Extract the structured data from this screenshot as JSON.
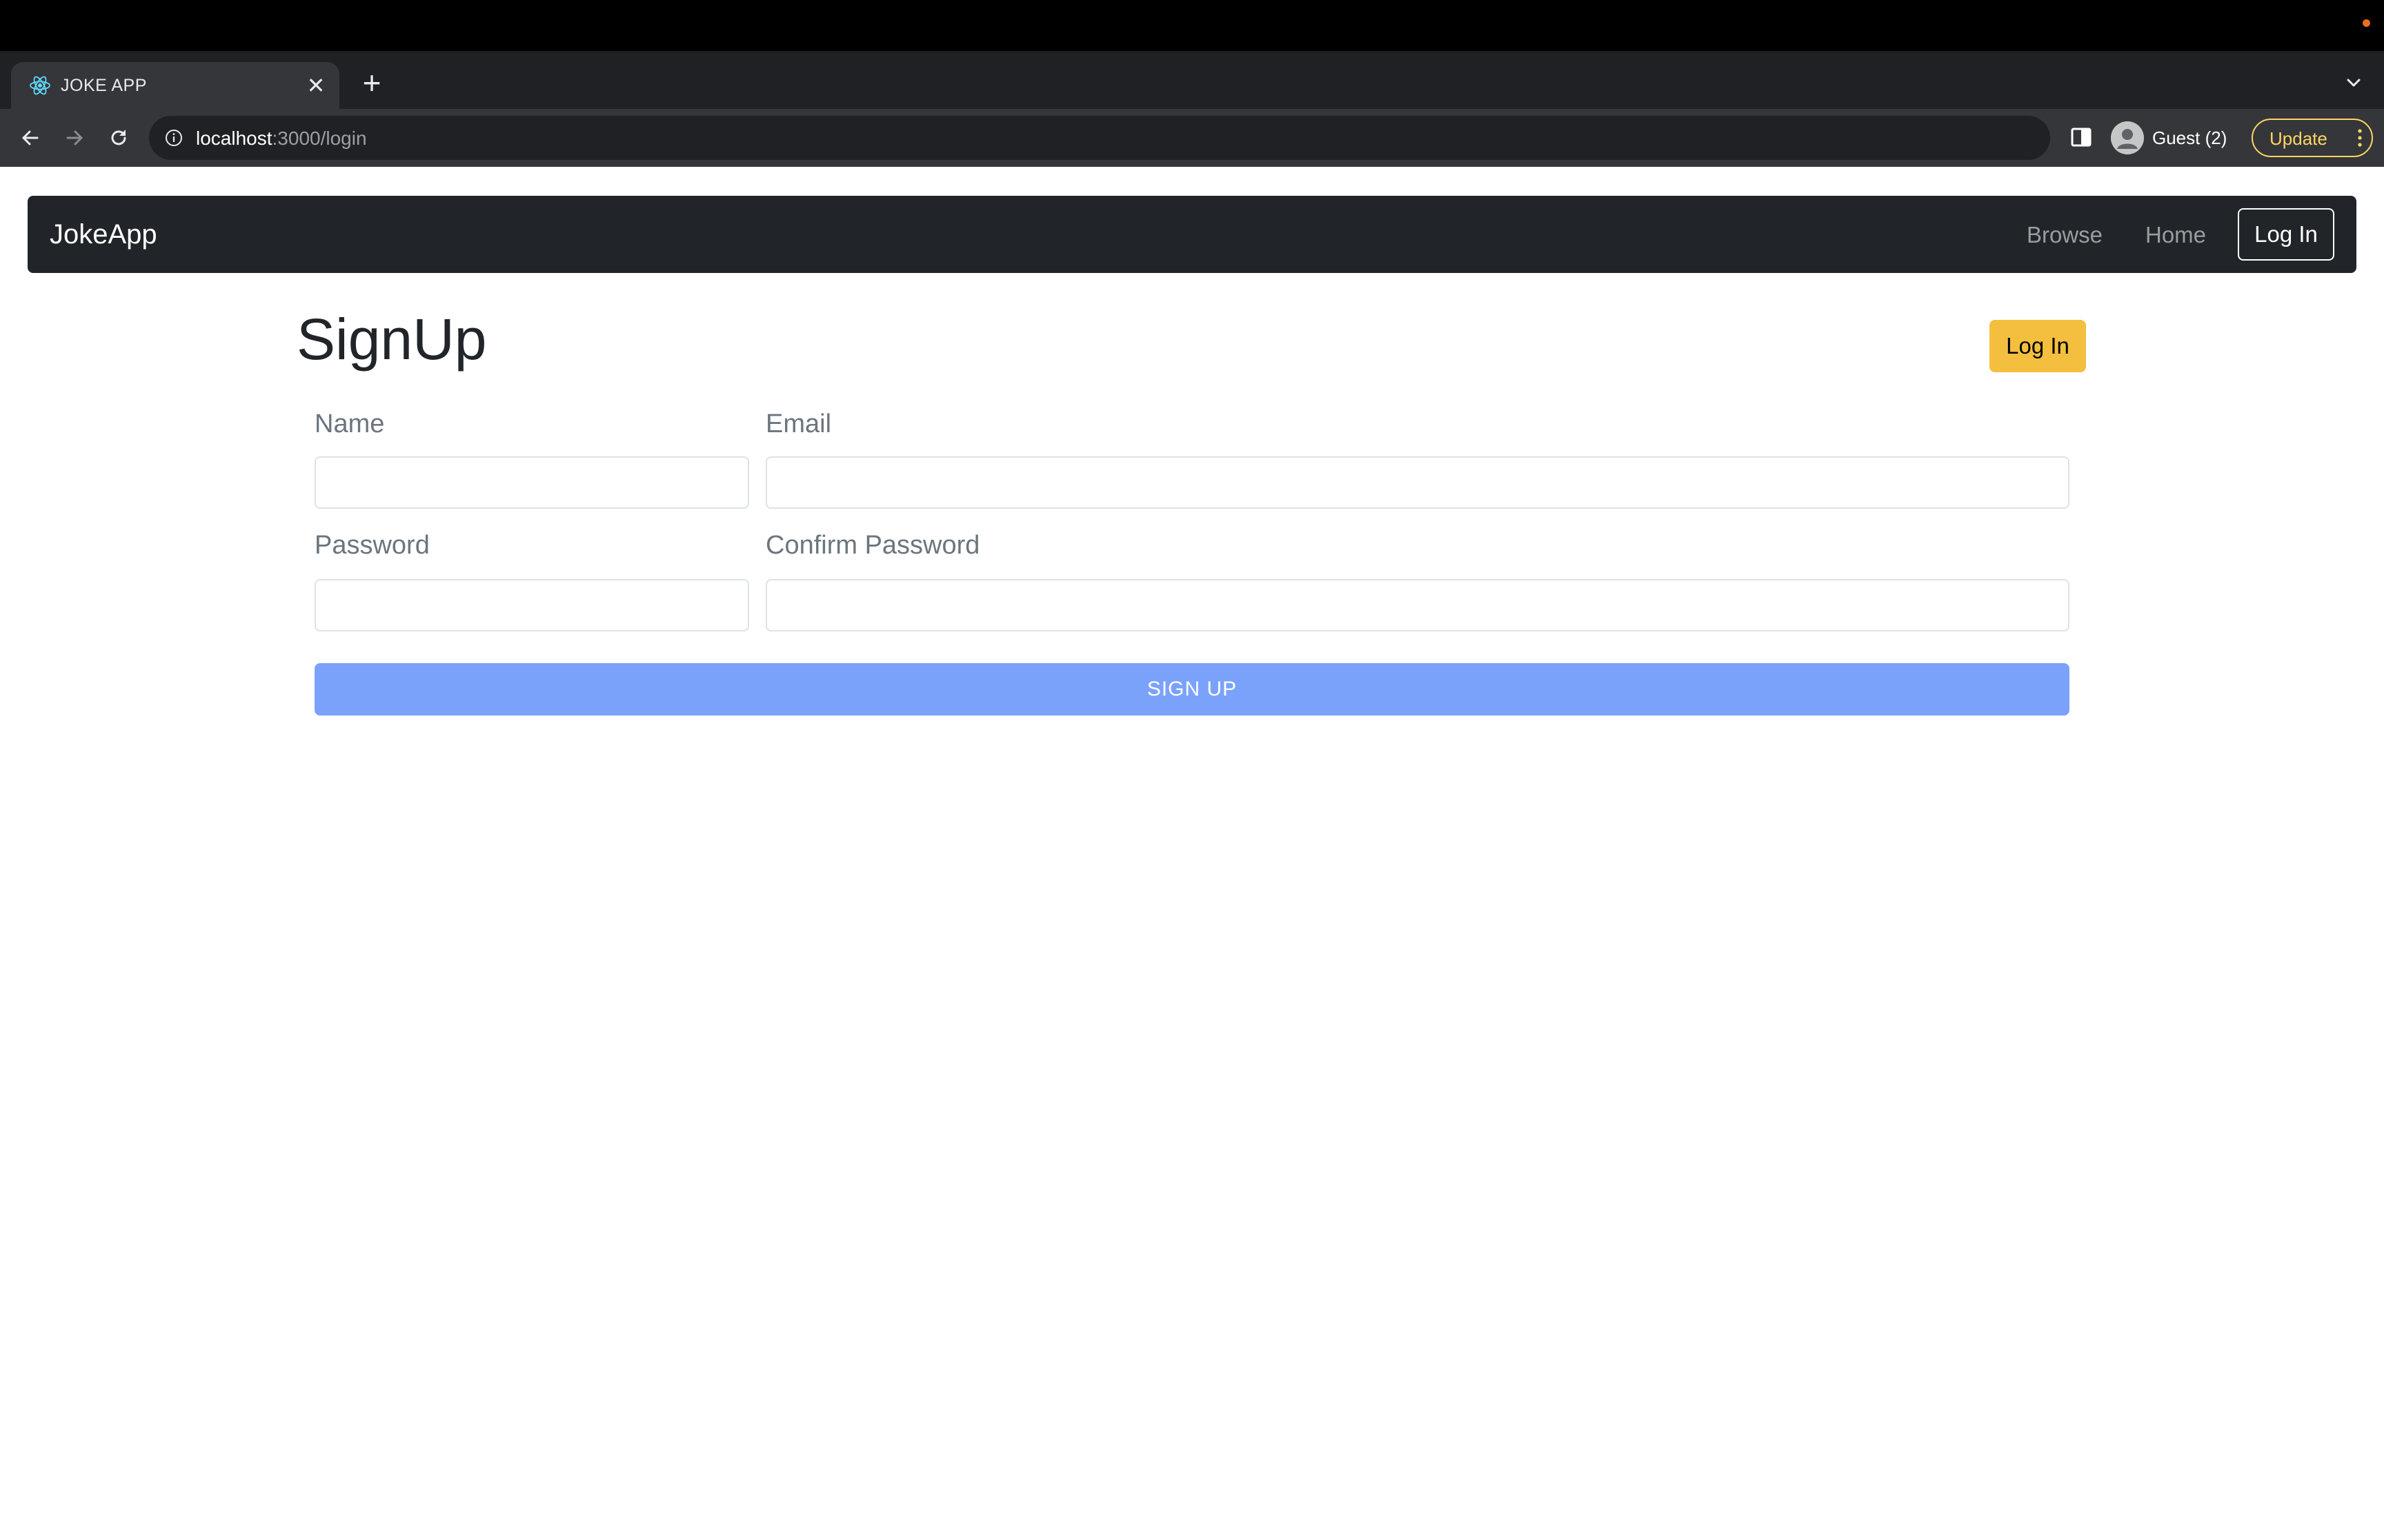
{
  "os": {
    "indicator_color": "#e8711c"
  },
  "browser": {
    "tab": {
      "title": "JOKE APP",
      "favicon": "react-icon"
    },
    "new_tab_label": "+",
    "close_label": "✕",
    "address": {
      "host": "localhost",
      "rest": ":3000/login"
    },
    "profile": {
      "label": "Guest (2)"
    },
    "update": {
      "label": "Update",
      "color": "#fdd663"
    }
  },
  "navbar": {
    "brand": "JokeApp",
    "links": [
      {
        "label": "Browse"
      },
      {
        "label": "Home"
      }
    ],
    "login_label": "Log In",
    "background": "#212529"
  },
  "main": {
    "title": "SignUp",
    "login_button_label": "Log In",
    "login_button_color": "#f4bf3f",
    "fields": {
      "name": {
        "label": "Name",
        "value": ""
      },
      "email": {
        "label": "Email",
        "value": ""
      },
      "password": {
        "label": "Password",
        "value": ""
      },
      "confirm_password": {
        "label": "Confirm Password",
        "value": ""
      }
    },
    "submit_label": "SIGN UP",
    "submit_color": "#7ba2fa"
  }
}
